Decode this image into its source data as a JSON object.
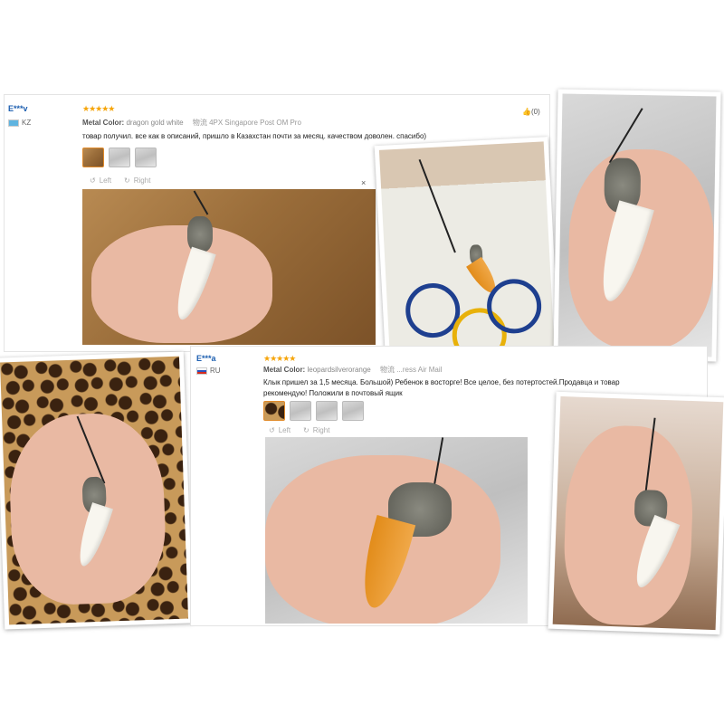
{
  "review1": {
    "user": "E***v",
    "country": "KZ",
    "stars": "★★★★★",
    "metal_label": "Metal Color:",
    "metal_value": "dragon gold white",
    "shipping": "物流 4PX Singapore Post OM Pro",
    "likes": "(0)",
    "text": "товар получил. все как в описаний, пришло в Казахстан почти за месяц. качеством доволен. спасибо)",
    "nav_left": "Left",
    "nav_right": "Right",
    "close": "×"
  },
  "review2": {
    "user": "E***a",
    "country": "RU",
    "stars": "★★★★★",
    "metal_label": "Metal Color:",
    "metal_value": "leopardsilverorange",
    "shipping": "物流 ...ress Air Mail",
    "text": "Клык пришел за 1,5 месяца. Большой) Ребенок в восторге! Все целое, без потертостей.Продавца и товар рекомендую! Положили в почтовый ящик",
    "nav_left": "Left",
    "nav_right": "Right"
  },
  "icons": {
    "thumbs_up": "thumbs-up-icon",
    "rotate_left": "rotate-left-icon",
    "rotate_right": "rotate-right-icon",
    "close": "close-icon"
  }
}
